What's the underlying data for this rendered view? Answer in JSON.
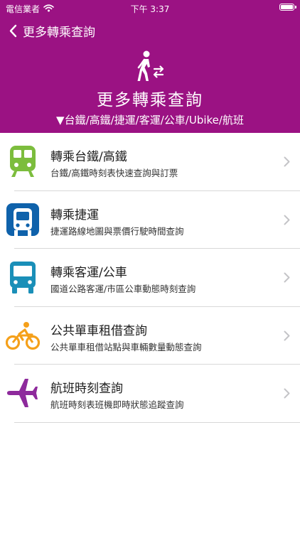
{
  "status_bar": {
    "carrier": "電信業者",
    "time": "下午 3:37",
    "wifi_icon": "wifi-icon",
    "battery_icon": "battery-full-icon"
  },
  "nav": {
    "back_icon": "chevron-left-icon",
    "title": "更多轉乘查詢"
  },
  "hero": {
    "icon": "person-transfer-icon",
    "title": "更多轉乘查詢",
    "subtitle": "▼台鐵/高鐵/捷運/客運/公車/Ubike/航班"
  },
  "colors": {
    "header_bg": "#9b1283",
    "rail_green": "#7cbd3d",
    "mrt_blue": "#0f62ab",
    "bus_teal": "#1a8fb8",
    "bike_orange": "#f5a01a",
    "plane_purple": "#8e2a9c",
    "chevron_gray": "#c4c4c7"
  },
  "items": [
    {
      "icon": "train-icon",
      "title": "轉乘台鐵/高鐵",
      "desc": "台鐵/高鐵時刻表快速查詢與訂票"
    },
    {
      "icon": "metro-icon",
      "title": "轉乘捷運",
      "desc": "捷運路線地圖與票價行駛時間查詢"
    },
    {
      "icon": "bus-icon",
      "title": "轉乘客運/公車",
      "desc": "國道公路客運/市區公車動態時刻查詢"
    },
    {
      "icon": "bicycle-icon",
      "title": "公共單車租借查詢",
      "desc": "公共單車租借站點與車輛數量動態查詢"
    },
    {
      "icon": "airplane-icon",
      "title": "航班時刻查詢",
      "desc": "航班時刻表班機即時狀態追蹤查詢"
    }
  ]
}
